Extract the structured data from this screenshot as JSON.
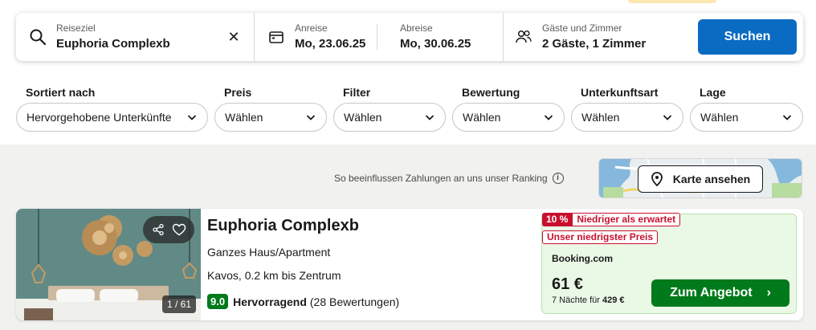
{
  "search": {
    "destination_label": "Reiseziel",
    "destination_value": "Euphoria Complexb",
    "clear_label": "✕",
    "checkin_label": "Anreise",
    "checkin_value": "Mo, 23.06.25",
    "checkout_label": "Abreise",
    "checkout_value": "Mo, 30.06.25",
    "guests_label": "Gäste und Zimmer",
    "guests_value": "2 Gäste, 1 Zimmer",
    "search_button": "Suchen"
  },
  "filters": [
    {
      "label": "Sortiert nach",
      "value": "Hervorgehobene Unterkünfte"
    },
    {
      "label": "Preis",
      "value": "Wählen"
    },
    {
      "label": "Filter",
      "value": "Wählen"
    },
    {
      "label": "Bewertung",
      "value": "Wählen"
    },
    {
      "label": "Unterkunftsart",
      "value": "Wählen"
    },
    {
      "label": "Lage",
      "value": "Wählen"
    }
  ],
  "ranking_note": "So beeinflussen Zahlungen an uns unser Ranking",
  "ranking_info_icon": "i",
  "map_button": "Karte ansehen",
  "result": {
    "name": "Euphoria Complexb",
    "type": "Ganzes Haus/Apartment",
    "location": "Kavos, 0.2 km bis Zentrum",
    "score": "9.0",
    "rating_word": "Hervorragend",
    "reviews": "(28 Bewertungen)",
    "image_counter": "1 / 61",
    "discount_pct": "10 %",
    "discount_text": "Niedriger als erwartet",
    "lowest_price_tag": "Unser niedrigster Preis",
    "provider": "Booking.com",
    "price": "61 €",
    "price_note_prefix": "7 Nächte für",
    "price_total": "429 €",
    "deal_button": "Zum Angebot",
    "deal_arrow": "›"
  },
  "colors": {
    "primary_blue": "#0a6bc2",
    "deal_green": "#007a1a",
    "deal_bg": "#eaf8e6",
    "discount_red": "#c8102e"
  }
}
